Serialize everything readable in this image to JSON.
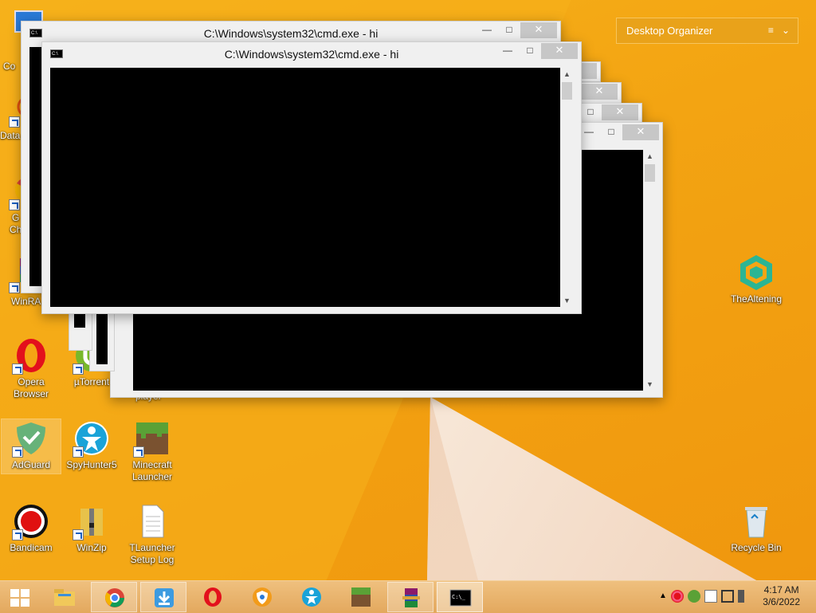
{
  "desktop_icons": [
    {
      "id": "computer",
      "label": "Co",
      "partial": true
    },
    {
      "id": "data",
      "label": "Data",
      "partial": true
    },
    {
      "id": "chrome",
      "label": "G\nCh",
      "partial": true
    },
    {
      "id": "winrar",
      "label": "WinRA",
      "partial": true
    },
    {
      "id": "opera",
      "label": "Opera\nBrowser"
    },
    {
      "id": "utorrent",
      "label": "µTorrent"
    },
    {
      "id": "player",
      "label": "player"
    },
    {
      "id": "adguard",
      "label": "AdGuard"
    },
    {
      "id": "spyhunter",
      "label": "SpyHunter5"
    },
    {
      "id": "minecraft",
      "label": "Minecraft\nLauncher"
    },
    {
      "id": "bandicam",
      "label": "Bandicam"
    },
    {
      "id": "winzip",
      "label": "WinZip"
    },
    {
      "id": "tlauncher-log",
      "label": "TLauncher\nSetup Log"
    },
    {
      "id": "thealtening",
      "label": "TheAltening"
    },
    {
      "id": "recycle-bin",
      "label": "Recycle Bin"
    }
  ],
  "organizer": {
    "title": "Desktop Organizer",
    "menu_glyph": "≡",
    "chevron": "⌄"
  },
  "cmd_windows": {
    "title": "C:\\Windows\\system32\\cmd.exe - hi",
    "minimize": "—",
    "maximize": "□",
    "close": "✕"
  },
  "taskbar": {
    "start": "start",
    "pinned": [
      "file-explorer",
      "chrome",
      "downloader",
      "opera",
      "avast-secure-browser",
      "spyhunter",
      "minecraft",
      "winrar",
      "cmd"
    ],
    "active": "cmd"
  },
  "clock": {
    "time": "4:17 AM",
    "date": "3/6/2022"
  },
  "colors": {
    "accent": "#f3a412",
    "taskbar": "#e6b26b",
    "console": "#000000"
  }
}
